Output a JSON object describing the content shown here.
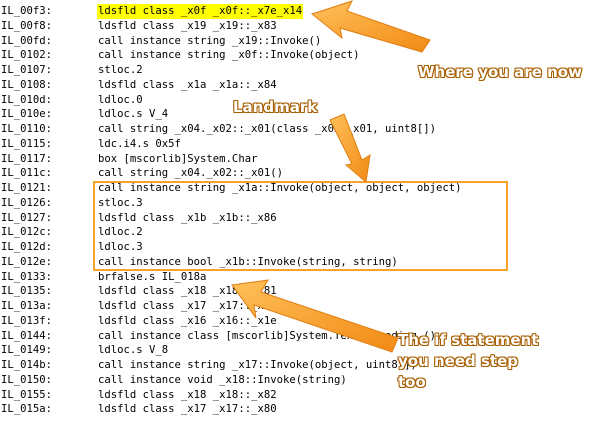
{
  "code_lines": [
    {
      "addr": "IL_00f3:",
      "instr": "ldsfld class _x0f _x0f::_x7e_x14",
      "highlight": true
    },
    {
      "addr": "IL_00f8:",
      "instr": "ldsfld class _x19 _x19::_x83"
    },
    {
      "addr": "IL_00fd:",
      "instr": "call instance string _x19::Invoke()"
    },
    {
      "addr": "IL_0102:",
      "instr": "call instance string _x0f::Invoke(object)"
    },
    {
      "addr": "IL_0107:",
      "instr": "stloc.2"
    },
    {
      "addr": "IL_0108:",
      "instr": "ldsfld class _x1a _x1a::_x84"
    },
    {
      "addr": "IL_010d:",
      "instr": "ldloc.0"
    },
    {
      "addr": "IL_010e:",
      "instr": "ldloc.s V_4"
    },
    {
      "addr": "IL_0110:",
      "instr": "call string _x04._x02::_x01(class _x03._x01, uint8[])"
    },
    {
      "addr": "IL_0115:",
      "instr": "ldc.i4.s 0x5f"
    },
    {
      "addr": "IL_0117:",
      "instr": "box [mscorlib]System.Char"
    },
    {
      "addr": "IL_011c:",
      "instr": "call string _x04._x02::_x01()"
    },
    {
      "addr": "IL_0121:",
      "instr": "call instance string _x1a::Invoke(object, object, object)"
    },
    {
      "addr": "IL_0126:",
      "instr": "stloc.3"
    },
    {
      "addr": "IL_0127:",
      "instr": "ldsfld class _x1b _x1b::_x86"
    },
    {
      "addr": "IL_012c:",
      "instr": "ldloc.2"
    },
    {
      "addr": "IL_012d:",
      "instr": "ldloc.3"
    },
    {
      "addr": "IL_012e:",
      "instr": "call instance bool _x1b::Invoke(string, string)"
    },
    {
      "addr": "IL_0133:",
      "instr": "brfalse.s IL_018a"
    },
    {
      "addr": "IL_0135:",
      "instr": "ldsfld class _x18 _x18::_x81"
    },
    {
      "addr": "IL_013a:",
      "instr": "ldsfld class _x17 _x17::_x80"
    },
    {
      "addr": "IL_013f:",
      "instr": "ldsfld class _x16 _x16::_x1e"
    },
    {
      "addr": "IL_0144:",
      "instr": "call instance class [mscorlib]System.Text.Encoding ()"
    },
    {
      "addr": "IL_0149:",
      "instr": "ldloc.s V_8"
    },
    {
      "addr": "IL_014b:",
      "instr": "call instance string _x17::Invoke(object, uint8[])"
    },
    {
      "addr": "IL_0150:",
      "instr": "call instance void _x18::Invoke(string)"
    },
    {
      "addr": "IL_0155:",
      "instr": "ldsfld class _x18 _x18::_x82"
    },
    {
      "addr": "IL_015a:",
      "instr": "ldsfld class _x17 _x17::_x80"
    }
  ],
  "annotations": {
    "current_position": "Where you are now",
    "landmark": "Landmark",
    "if_statement_line1": "The if statement",
    "if_statement_line2": "you need step",
    "if_statement_line3": "too"
  },
  "colors": {
    "highlight": "#ffff00",
    "callout": "#f7a22d",
    "callout_text": "#ffffff"
  }
}
